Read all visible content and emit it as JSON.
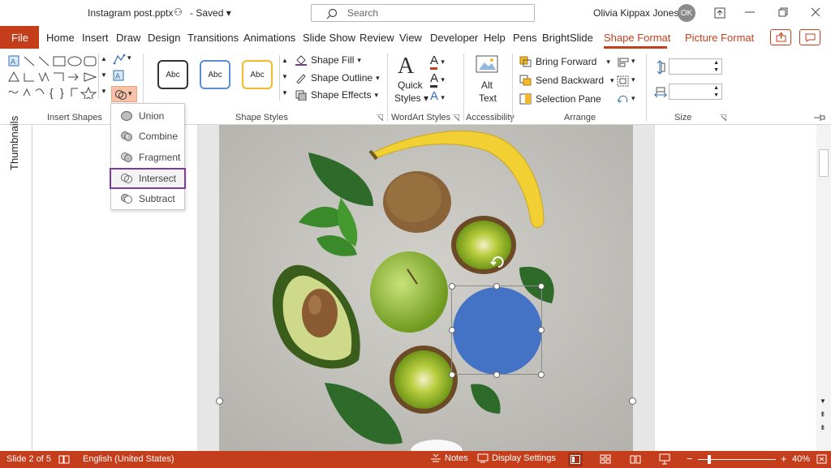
{
  "titlebar": {
    "filename": "Instagram post.pptx",
    "saved": "Saved",
    "search_placeholder": "Search",
    "user_name": "Olivia Kippax Jones",
    "user_initials": "OK"
  },
  "tabs": [
    "File",
    "Home",
    "Insert",
    "Draw",
    "Design",
    "Transitions",
    "Animations",
    "Slide Show",
    "Review",
    "View",
    "Developer",
    "Help",
    "Pens",
    "BrightSlide",
    "Shape Format",
    "Picture Format"
  ],
  "ribbon": {
    "groups": {
      "insert_shapes": "Insert Shapes",
      "shape_styles": "Shape Styles",
      "wordart_styles": "WordArt Styles",
      "accessibility": "Accessibility",
      "arrange": "Arrange",
      "size": "Size"
    },
    "shape_style_sample": "Abc",
    "shape_fill": "Shape Fill",
    "shape_outline": "Shape Outline",
    "shape_effects": "Shape Effects",
    "quick_styles_line1": "Quick",
    "quick_styles_line2": "Styles",
    "alt_text_line1": "Alt",
    "alt_text_line2": "Text",
    "bring_forward": "Bring Forward",
    "send_backward": "Send Backward",
    "selection_pane": "Selection Pane"
  },
  "merge_menu": {
    "items": [
      "Union",
      "Combine",
      "Fragment",
      "Intersect",
      "Subtract"
    ],
    "highlighted": "Intersect"
  },
  "side_panel": {
    "thumbnails_label": "Thumbnails"
  },
  "status": {
    "slide": "Slide 2 of 5",
    "language": "English (United States)",
    "notes": "Notes",
    "display_settings": "Display Settings",
    "zoom": "40%"
  },
  "colors": {
    "accent": "#c43e1c",
    "shape_fill": "#4472c4",
    "menu_highlight": "#7e3a9e"
  }
}
